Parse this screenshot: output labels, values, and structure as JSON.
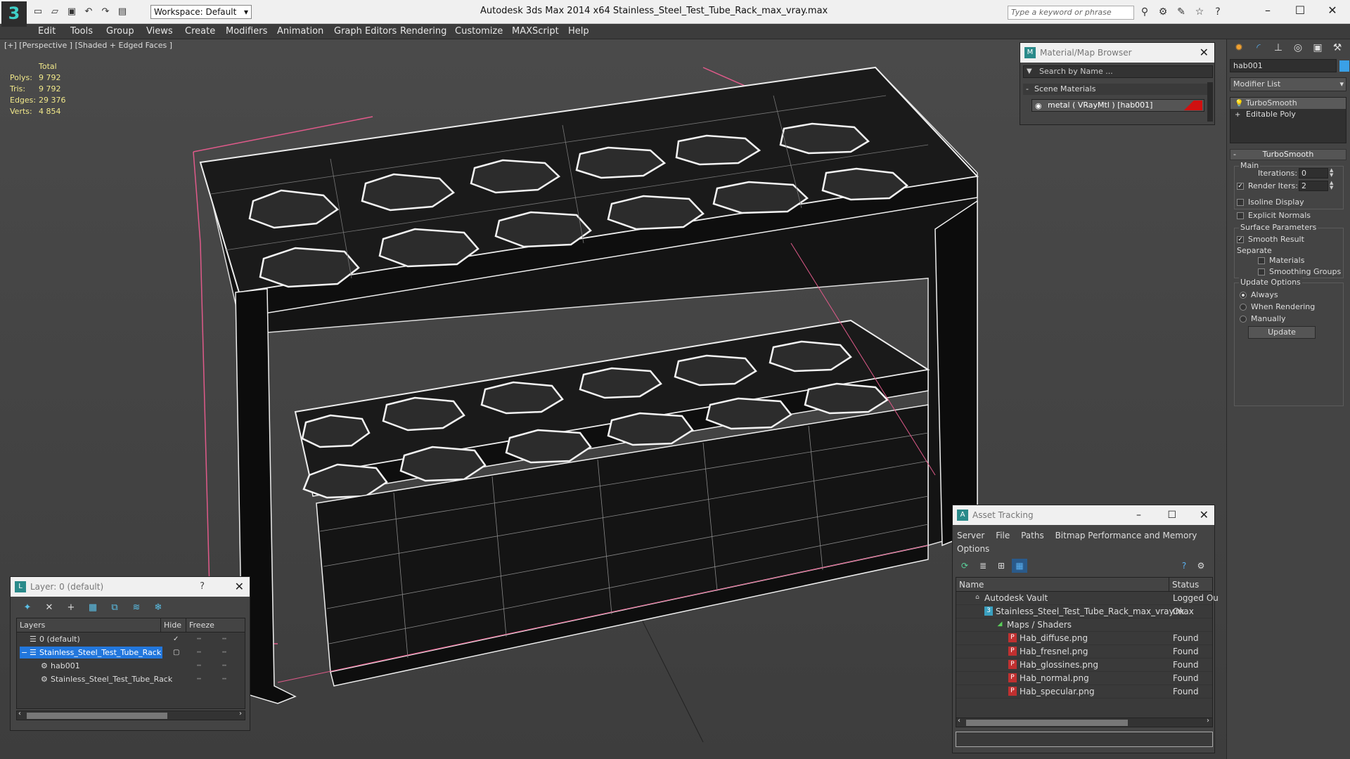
{
  "titlebar": {
    "logo": "3",
    "workspace": "Workspace: Default",
    "title": "Autodesk 3ds Max  2014 x64      Stainless_Steel_Test_Tube_Rack_max_vray.max",
    "search_placeholder": "Type a keyword or phrase"
  },
  "menu": [
    "Edit",
    "Tools",
    "Group",
    "Views",
    "Create",
    "Modifiers",
    "Animation",
    "Graph Editors",
    "Rendering",
    "Customize",
    "MAXScript",
    "Help"
  ],
  "viewport": {
    "label": "[+] [Perspective ] [Shaded + Edged Faces ]",
    "stats": {
      "header": "Total",
      "rows": [
        {
          "k": "Polys:",
          "v": "9 792"
        },
        {
          "k": "Tris:",
          "v": "9 792"
        },
        {
          "k": "Edges:",
          "v": "29 376"
        },
        {
          "k": "Verts:",
          "v": "4 854"
        }
      ]
    }
  },
  "command_panel": {
    "object_name": "hab001",
    "modifier_list": "Modifier List",
    "stack": [
      "TurboSmooth",
      "Editable Poly"
    ],
    "rollout_title": "TurboSmooth",
    "main_group": "Main",
    "iterations_label": "Iterations:",
    "iterations_value": "0",
    "render_iters_label": "Render Iters:",
    "render_iters_value": "2",
    "isoline_display": "Isoline Display",
    "explicit_normals": "Explicit Normals",
    "surface_group": "Surface Parameters",
    "smooth_result": "Smooth Result",
    "separate": "Separate",
    "materials": "Materials",
    "smoothing_groups": "Smoothing Groups",
    "update_group": "Update Options",
    "always": "Always",
    "when_rendering": "When Rendering",
    "manually": "Manually",
    "update_button": "Update"
  },
  "material_browser": {
    "title": "Material/Map Browser",
    "search_placeholder": "Search by Name ...",
    "section": "Scene Materials",
    "material": "metal  ( VRayMtl )  [hab001]"
  },
  "layer_window": {
    "title": "Layer: 0 (default)",
    "help": "?",
    "col_layers": "Layers",
    "col_hide": "Hide",
    "col_freeze": "Freeze",
    "rows": [
      {
        "name": "0 (default)"
      },
      {
        "name": "Stainless_Steel_Test_Tube_Rack"
      },
      {
        "name": "hab001"
      },
      {
        "name": "Stainless_Steel_Test_Tube_Rack"
      }
    ]
  },
  "asset_tracking": {
    "title": "Asset Tracking",
    "menu": [
      "Server",
      "File",
      "Paths",
      "Bitmap Performance and Memory",
      "Options"
    ],
    "col_name": "Name",
    "col_status": "Status",
    "rows": [
      {
        "name": "Autodesk Vault",
        "status": "Logged Ou"
      },
      {
        "name": "Stainless_Steel_Test_Tube_Rack_max_vray.max",
        "status": "Ok"
      },
      {
        "name": "Maps / Shaders",
        "status": ""
      },
      {
        "name": "Hab_diffuse.png",
        "status": "Found"
      },
      {
        "name": "Hab_fresnel.png",
        "status": "Found"
      },
      {
        "name": "Hab_glossines.png",
        "status": "Found"
      },
      {
        "name": "Hab_normal.png",
        "status": "Found"
      },
      {
        "name": "Hab_specular.png",
        "status": "Found"
      }
    ]
  }
}
